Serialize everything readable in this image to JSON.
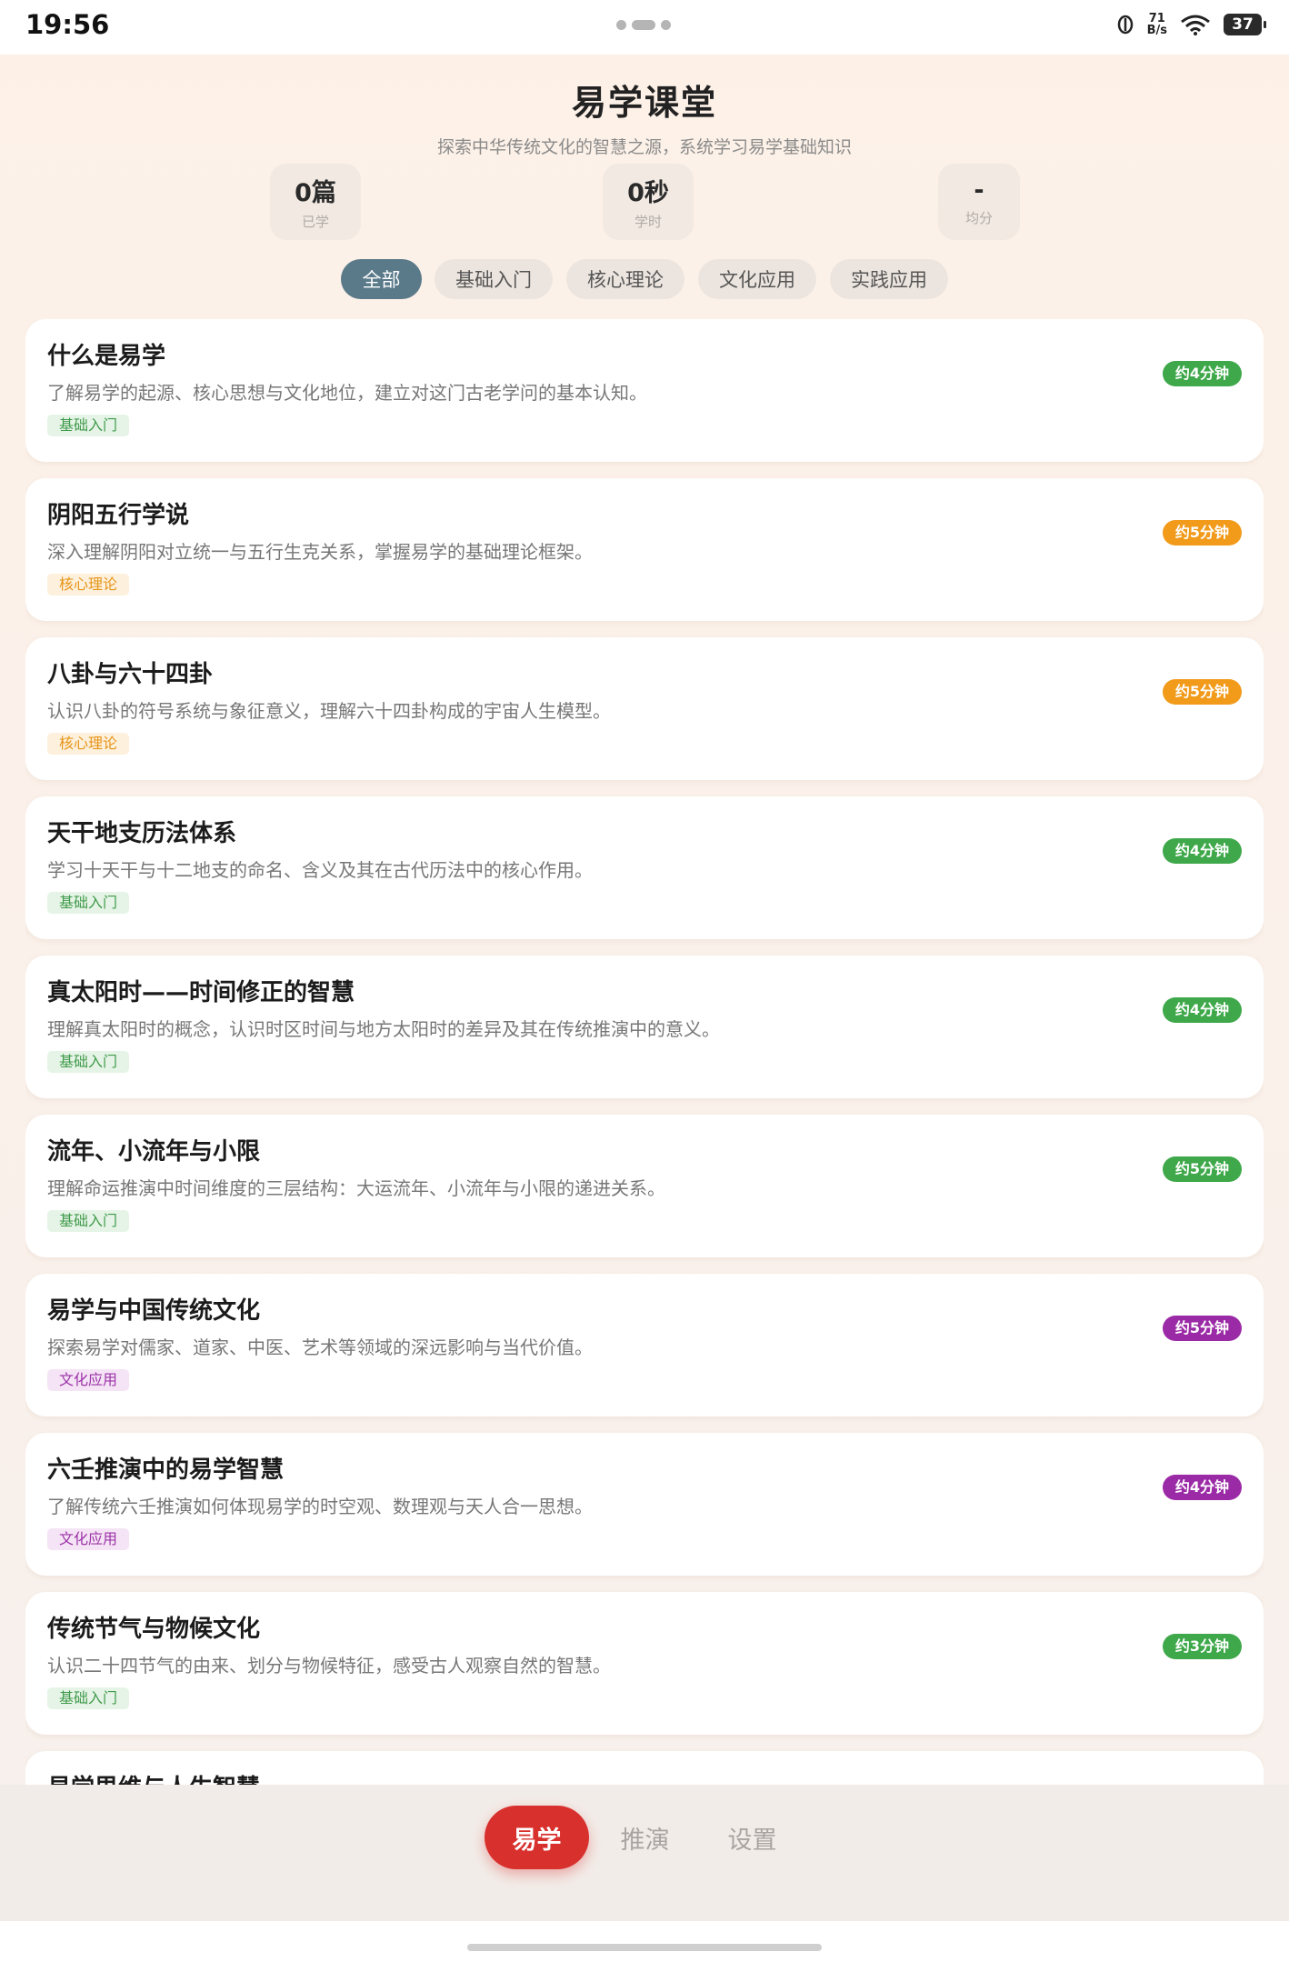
{
  "status": {
    "time": "19:56",
    "net_speed_top": "71",
    "net_speed_bottom": "B/s",
    "battery": "37"
  },
  "header": {
    "title": "易学课堂",
    "subtitle": "探索中华传统文化的智慧之源，系统学习易学基础知识"
  },
  "stats": [
    {
      "value": "0篇",
      "label": "已学"
    },
    {
      "value": "0秒",
      "label": "学时"
    },
    {
      "value": "-",
      "label": "均分"
    }
  ],
  "filters": [
    "全部",
    "基础入门",
    "核心理论",
    "文化应用",
    "实践应用"
  ],
  "active_filter": "全部",
  "lessons": [
    {
      "title": "什么是易学",
      "desc": "了解易学的起源、核心思想与文化地位，建立对这门古老学问的基本认知。",
      "tag": "基础入门",
      "time": "约4分钟"
    },
    {
      "title": "阴阳五行学说",
      "desc": "深入理解阴阳对立统一与五行生克关系，掌握易学的基础理论框架。",
      "tag": "核心理论",
      "time": "约5分钟"
    },
    {
      "title": "八卦与六十四卦",
      "desc": "认识八卦的符号系统与象征意义，理解六十四卦构成的宇宙人生模型。",
      "tag": "核心理论",
      "time": "约5分钟"
    },
    {
      "title": "天干地支历法体系",
      "desc": "学习十天干与十二地支的命名、含义及其在古代历法中的核心作用。",
      "tag": "基础入门",
      "time": "约4分钟"
    },
    {
      "title": "真太阳时——时间修正的智慧",
      "desc": "理解真太阳时的概念，认识时区时间与地方太阳时的差异及其在传统推演中的意义。",
      "tag": "基础入门",
      "time": "约4分钟"
    },
    {
      "title": "流年、小流年与小限",
      "desc": "理解命运推演中时间维度的三层结构：大运流年、小流年与小限的递进关系。",
      "tag": "基础入门",
      "time": "约5分钟"
    },
    {
      "title": "易学与中国传统文化",
      "desc": "探索易学对儒家、道家、中医、艺术等领域的深远影响与当代价值。",
      "tag": "文化应用",
      "time": "约5分钟"
    },
    {
      "title": "六壬推演中的易学智慧",
      "desc": "了解传统六壬推演如何体现易学的时空观、数理观与天人合一思想。",
      "tag": "文化应用",
      "time": "约4分钟"
    },
    {
      "title": "传统节气与物候文化",
      "desc": "认识二十四节气的由来、划分与物候特征，感受古人观察自然的智慧。",
      "tag": "基础入门",
      "time": "约3分钟"
    },
    {
      "title": "易学思维与人生智慧",
      "desc": "",
      "tag": "",
      "time": ""
    }
  ],
  "tag_colors": {
    "基础入门": {
      "bg": "#e6f4e7",
      "fg": "#3f9a4a"
    },
    "核心理论": {
      "bg": "#fdf0dc",
      "fg": "#e69417"
    },
    "文化应用": {
      "bg": "#f5e4f5",
      "fg": "#9c32a8"
    }
  },
  "time_colors": {
    "基础入门": "#3ea84a",
    "核心理论": "#f29a1a",
    "文化应用": "#9b2aa6"
  },
  "nav": {
    "items": [
      "易学",
      "推演",
      "设置"
    ],
    "active": "易学"
  }
}
